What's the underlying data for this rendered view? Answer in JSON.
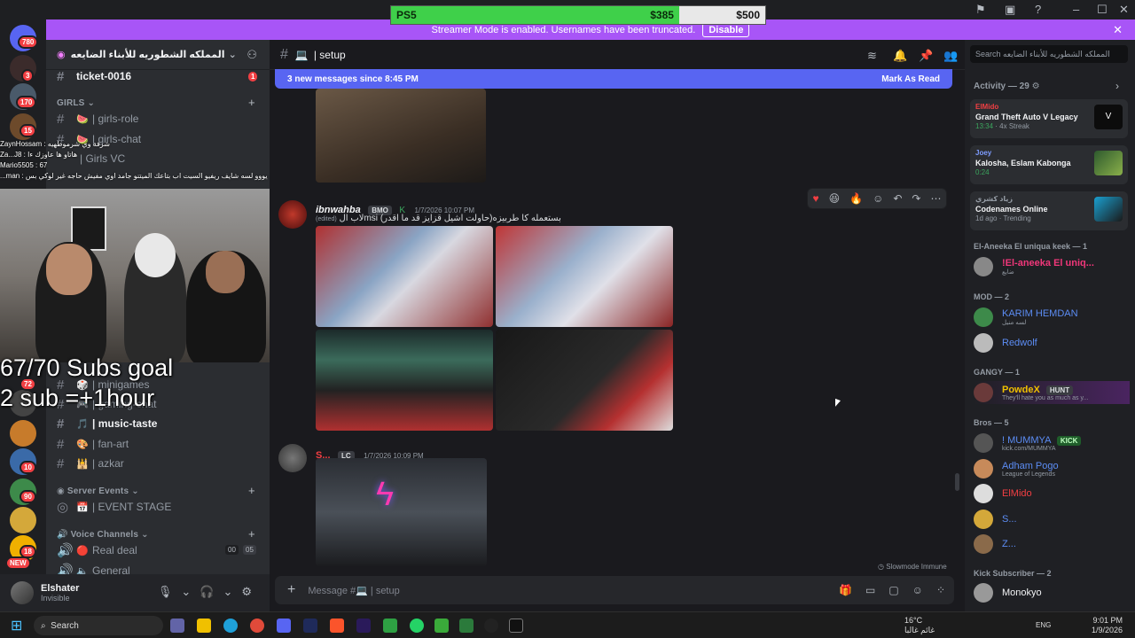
{
  "goal_bar": {
    "left": "PS5",
    "current": "$385",
    "target": "$500",
    "progress": 0.77
  },
  "streamer": {
    "message": "Streamer Mode is enabled. Usernames have been truncated.",
    "button": "Disable"
  },
  "rail_badges": {
    "home": "780",
    "s1": "3",
    "s2": "170",
    "s3": "15",
    "s4": "72",
    "s5": "10",
    "s6": "90",
    "s7": "18",
    "new": "NEW"
  },
  "server": {
    "name": "المملكه الشطوريه للأبناء الضايعه"
  },
  "channels": {
    "ticket": {
      "name": "ticket-0016",
      "badge": "1"
    },
    "cat_girls": "GIRLS",
    "girls_role": "| girls-role",
    "girls_chat": "| girls-chat",
    "girls_vc": "| Girls VC",
    "minigames": "| minigames",
    "gaming": "| gaming-chat",
    "music": "| music-taste",
    "fanart": "| fan-art",
    "azkar": "| azkar",
    "cat_events": "Server Events",
    "event_stage": "| EVENT STAGE",
    "cat_voice": "Voice Channels",
    "real_deal": "Real deal",
    "real_deal_counts": [
      "00",
      "05"
    ],
    "general": "General"
  },
  "user": {
    "name": "Elshater",
    "status": "Invisible"
  },
  "overlay": {
    "goal_line1": "67/70 Subs goal",
    "goal_line2": "2 sub =+1hour",
    "chat": [
      "ZaynHossam : شرفة وي شرموطهيه",
      "Za...J8 : هاتاو ها عاوزك ءا",
      "Mario5505 : 67",
      "...man : يووو لسه شايف ريفيو السيت اب بتاعك الميتنو جامد اوي مفيش حاجه غير لوكي بس"
    ]
  },
  "channel_header": {
    "name": "| setup"
  },
  "new_messages": {
    "text": "3 new messages since 8:45 PM",
    "action": "Mark As Read"
  },
  "messages": [
    {
      "author": "ibnwahba",
      "tag": "BMO",
      "time": "1/7/2026 10:07 PM",
      "edited": "(edited)",
      "text": "لاب الmsi بستعمله كا طربيزه(حاولت اشيل قزايز قد ما اقدر)"
    },
    {
      "author": "S...",
      "tag": "LC",
      "time": "1/7/2026 10:09 PM"
    }
  ],
  "composer": {
    "placeholder": "Message #💻 | setup"
  },
  "slowmode": "Slowmode Immune",
  "search": {
    "placeholder": "Search المملكه الشطوريه للأبناء الضايعه"
  },
  "activity": {
    "header": "Activity — 29",
    "cards": [
      {
        "user": "ElMido",
        "game": "Grand Theft Auto V Legacy",
        "meta": "13:34",
        "meta2": "4x Streak"
      },
      {
        "user": "Joey",
        "game": "Kalosha, Eslam Kabonga",
        "meta": "0:24"
      },
      {
        "user": "زياد كشري",
        "game": "Codenames Online",
        "meta": "1d ago",
        "meta2": "Trending"
      }
    ]
  },
  "member_groups": [
    {
      "title": "El-Aneeka El uniqua keek — 1",
      "members": [
        {
          "name": "!El-aneeka El uniq...",
          "sub": "ضايع"
        }
      ]
    },
    {
      "title": "MOD — 2",
      "members": [
        {
          "name": "KARIM HEMDAN",
          "sub": "لسه منيل"
        },
        {
          "name": "Redwolf",
          "sub": ""
        }
      ]
    },
    {
      "title": "GANGY — 1",
      "members": [
        {
          "name": "PowdeX",
          "sub": "They'll hate you as much as y..."
        }
      ]
    },
    {
      "title": "Bros — 5",
      "members": [
        {
          "name": "! MUMMYA",
          "sub": "kick.com/MUMMYA"
        },
        {
          "name": "Adham Pogo",
          "sub": "League of Legends"
        },
        {
          "name": "ElMido",
          "sub": ""
        },
        {
          "name": "S...",
          "sub": ""
        },
        {
          "name": "Z...",
          "sub": ""
        }
      ]
    },
    {
      "title": "Kick Subscriber — 2",
      "members": [
        {
          "name": "Monokyo",
          "sub": ""
        }
      ]
    }
  ],
  "member_tags": {
    "powdex": "HUNT",
    "mummya": "KICK"
  },
  "taskbar": {
    "search": "Search",
    "weather_temp": "16°C",
    "weather_desc": "غائم غالبا",
    "lang": "ENG",
    "time": "9:01 PM",
    "date": "1/9/2026"
  },
  "colors": {
    "accent": "#5865f2",
    "streamer": "#a855f7",
    "goal_fill": "#3fd04a",
    "badge": "#f23f43"
  }
}
